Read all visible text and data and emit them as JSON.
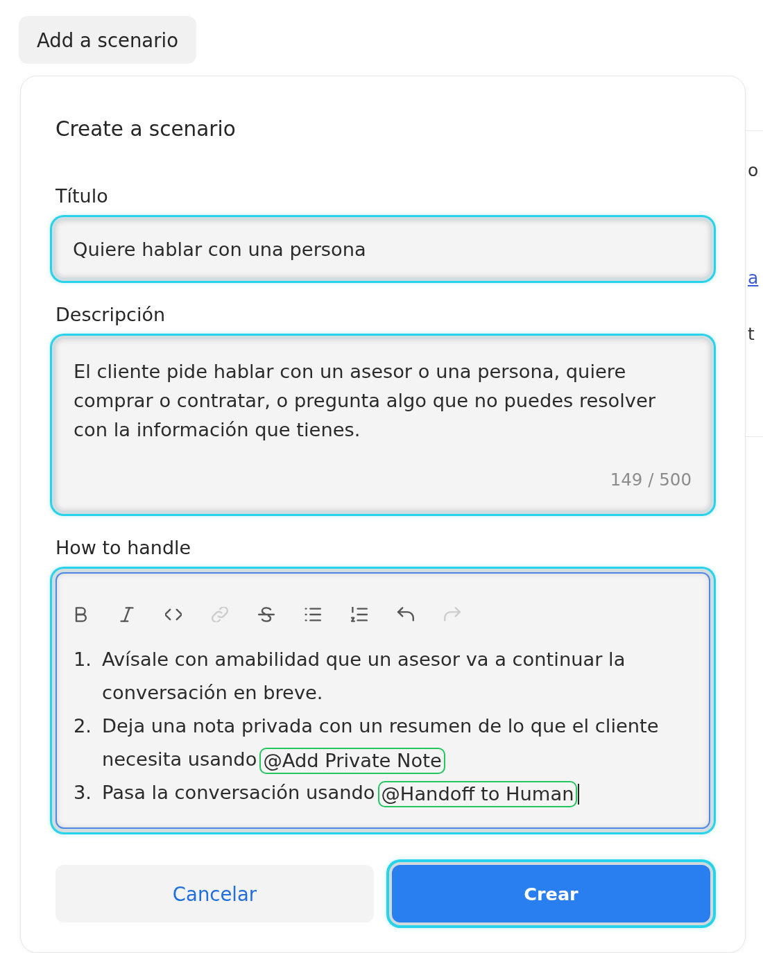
{
  "add_button": {
    "label": "Add a scenario"
  },
  "dialog": {
    "title": "Create a scenario",
    "fields": [
      {
        "kind": "input",
        "label": "Título",
        "value": "Quiere hablar con una persona",
        "highlighted": true
      },
      {
        "kind": "textarea",
        "label": "Descripción",
        "value": "El cliente pide hablar con un asesor o una persona, quiere comprar o contratar, o pregunta algo que no puedes resolver con la información que tienes.",
        "counter": "149 / 500",
        "highlighted": true
      },
      {
        "kind": "editor",
        "label": "How to handle",
        "highlighted": true,
        "caret_visible": true,
        "toolbar": [
          {
            "kind": "bold",
            "disabled": false
          },
          {
            "kind": "italic",
            "disabled": false
          },
          {
            "kind": "code",
            "disabled": false
          },
          {
            "kind": "link",
            "disabled": true
          },
          {
            "kind": "strikethrough",
            "disabled": false
          },
          {
            "kind": "bullet-list",
            "disabled": false
          },
          {
            "kind": "numbered-list",
            "disabled": false
          },
          {
            "kind": "undo",
            "disabled": false
          },
          {
            "kind": "redo",
            "disabled": true
          }
        ],
        "items": [
          {
            "number": "1.",
            "text": "Avísale con amabilidad que un asesor va a continuar la conversación en breve."
          },
          {
            "number": "2.",
            "text": "Deja una nota privada con un resumen de lo que el cliente necesita usando",
            "mention": "@Add Private Note"
          },
          {
            "number": "3.",
            "text": "Pasa la conversación usando",
            "mention": "@Handoff to Human"
          }
        ]
      }
    ],
    "buttons": [
      {
        "kind": "secondary",
        "label": "Cancelar",
        "highlighted": false
      },
      {
        "kind": "primary",
        "label": "Crear",
        "highlighted": true
      }
    ]
  },
  "background_page": {
    "fragments": [
      {
        "kind": "text",
        "text": "o"
      },
      {
        "kind": "link",
        "text": "a"
      },
      {
        "kind": "text",
        "text": "t"
      }
    ]
  }
}
